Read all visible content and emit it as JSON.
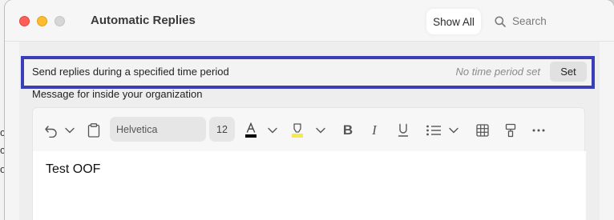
{
  "window": {
    "title": "Automatic Replies",
    "show_all_label": "Show All",
    "search_placeholder": "Search"
  },
  "time_period": {
    "label": "Send replies during a specified time period",
    "status": "No time period set",
    "set_label": "Set"
  },
  "message": {
    "label": "Message for inside your organization",
    "font_name": "Helvetica",
    "font_size": "12",
    "body_text": "Test OOF"
  },
  "colors": {
    "highlight_border": "#3a3fb8",
    "close": "#fe5f57",
    "minimize": "#febc2e",
    "zoom": "#d6d6d6",
    "font_color_swatch": "#000000",
    "highlight_color_swatch": "#f6e94a"
  },
  "icons": {
    "toolbar": [
      "undo-icon",
      "chevron-down-icon",
      "clipboard-icon",
      "font-color-icon",
      "highlight-icon",
      "bold-icon",
      "italic-icon",
      "underline-icon",
      "bullet-list-icon",
      "table-icon",
      "format-painter-icon",
      "more-icon"
    ]
  }
}
